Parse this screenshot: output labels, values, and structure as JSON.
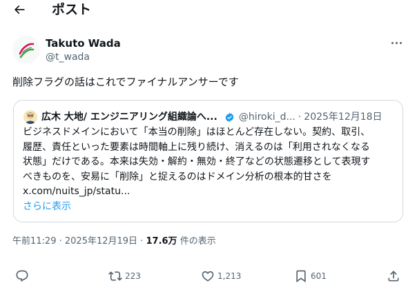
{
  "header": {
    "title": "ポスト",
    "back_icon": "arrow-left-icon"
  },
  "author": {
    "name": "Takuto Wada",
    "handle": "@t_wada",
    "avatar_icon": "logo-avatar"
  },
  "tweet": {
    "text": "削除フラグの話はこれでファイナルアンサーです"
  },
  "quote": {
    "name": "広木 大地/ エンジニアリング組織論へ...",
    "verified_icon": "verified-badge-icon",
    "handle": "@hiroki_d...",
    "separator": "·",
    "date": "2025年12月18日",
    "lines": [
      "ビジネスドメインにおいて「本当の削除」はほとんど存在しない。契約、取引、",
      "履歴、責任といった要素は時間軸上に残り続け、消えるのは「利用されなくなる",
      "状態」だけである。本来は失効・解約・無効・終了などの状態遷移として表現す",
      "べきものを、安易に「削除」と捉えるのはドメイン分析の根本的甘さを"
    ],
    "url": "x.com/nuits_jp/statu...",
    "show_more": "さらに表示"
  },
  "meta": {
    "time": "午前11:29",
    "separator": "·",
    "date": "2025年12月19日",
    "views": "17.6万",
    "views_label": "件の表示"
  },
  "actions": {
    "reply": {
      "icon": "reply-icon",
      "count": ""
    },
    "repost": {
      "icon": "repost-icon",
      "count": "223"
    },
    "like": {
      "icon": "heart-icon",
      "count": "1,213"
    },
    "bookmark": {
      "icon": "bookmark-icon",
      "count": "601"
    },
    "share": {
      "icon": "share-icon",
      "count": ""
    }
  },
  "colors": {
    "text": "#0f1419",
    "secondary": "#536471",
    "link": "#1d9bf0",
    "border": "#cfd9de"
  }
}
